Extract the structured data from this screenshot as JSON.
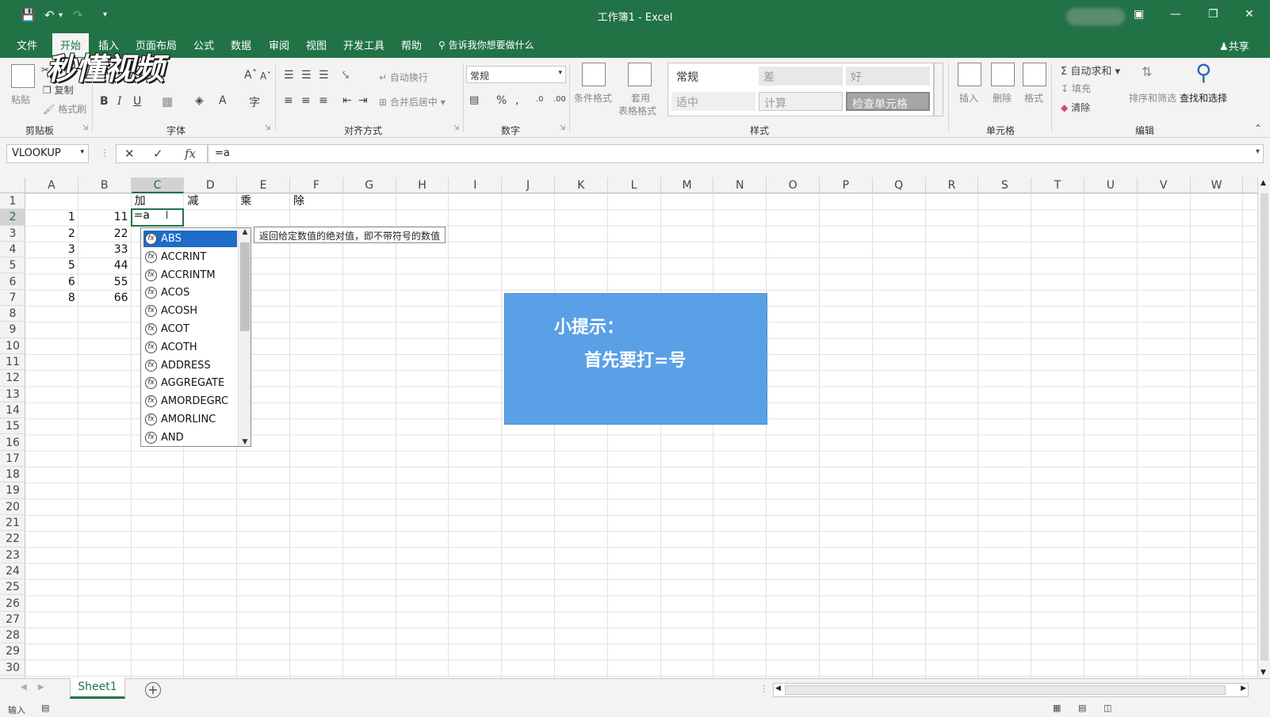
{
  "window": {
    "title": "工作簿1 - Excel"
  },
  "menu": {
    "tabs": [
      "文件",
      "开始",
      "插入",
      "页面布局",
      "公式",
      "数据",
      "审阅",
      "视图",
      "开发工具",
      "帮助"
    ],
    "tell_me": "告诉我你想要做什么",
    "share": "共享"
  },
  "watermark": "秒懂视频",
  "ribbon": {
    "clipboard": {
      "label": "剪贴板",
      "paste": "粘贴",
      "cut": "剪切",
      "copy": "复制",
      "format_painter": "格式刷"
    },
    "font": {
      "label": "字体",
      "bold": "B",
      "italic": "I",
      "underline": "U"
    },
    "alignment": {
      "label": "对齐方式",
      "wrap": "自动换行",
      "merge": "合并后居中"
    },
    "number": {
      "label": "数字",
      "format": "常规"
    },
    "styles": {
      "label": "样式",
      "conditional": "条件格式",
      "table_line1": "套用",
      "table_line2": "表格格式",
      "normal": "常规",
      "bad": "差",
      "good": "好",
      "neutral": "适中",
      "calculation": "计算",
      "check_cell": "检查单元格"
    },
    "cells": {
      "label": "单元格",
      "insert": "插入",
      "delete": "删除",
      "format": "格式"
    },
    "editing": {
      "label": "编辑",
      "autosum": "自动求和",
      "fill": "填充",
      "clear": "清除",
      "sort": "排序和筛选",
      "find": "查找和选择"
    }
  },
  "formula_bar": {
    "name_box": "VLOOKUP",
    "formula": "=a"
  },
  "grid": {
    "columns": [
      "A",
      "B",
      "C",
      "D",
      "E",
      "F",
      "G",
      "H",
      "I",
      "J",
      "K",
      "L",
      "M",
      "N",
      "O",
      "P",
      "Q",
      "R",
      "S",
      "T",
      "U",
      "V",
      "W"
    ],
    "selected_column": "C",
    "selected_row": 2,
    "row_count": 30,
    "headers_row1": {
      "C": "加",
      "D": "减",
      "E": "乘",
      "F": "除"
    },
    "column_a": [
      "1",
      "2",
      "3",
      "5",
      "6",
      "8"
    ],
    "column_b": [
      "11",
      "22",
      "33",
      "44",
      "55",
      "66"
    ],
    "editing_value": "=a"
  },
  "autocomplete": {
    "items": [
      "ABS",
      "ACCRINT",
      "ACCRINTM",
      "ACOS",
      "ACOSH",
      "ACOT",
      "ACOTH",
      "ADDRESS",
      "AGGREGATE",
      "AMORDEGRC",
      "AMORLINC",
      "AND"
    ],
    "selected_index": 0,
    "tooltip": "返回给定数值的绝对值，即不带符号的数值"
  },
  "tip": {
    "title": "小提示：",
    "body": "首先要打=号"
  },
  "sheets": {
    "tabs": [
      "Sheet1"
    ]
  },
  "status": {
    "mode": "输入"
  },
  "colors": {
    "brand": "#217346",
    "tip_bg": "#5aa0e6",
    "selection": "#1e6cc7"
  }
}
